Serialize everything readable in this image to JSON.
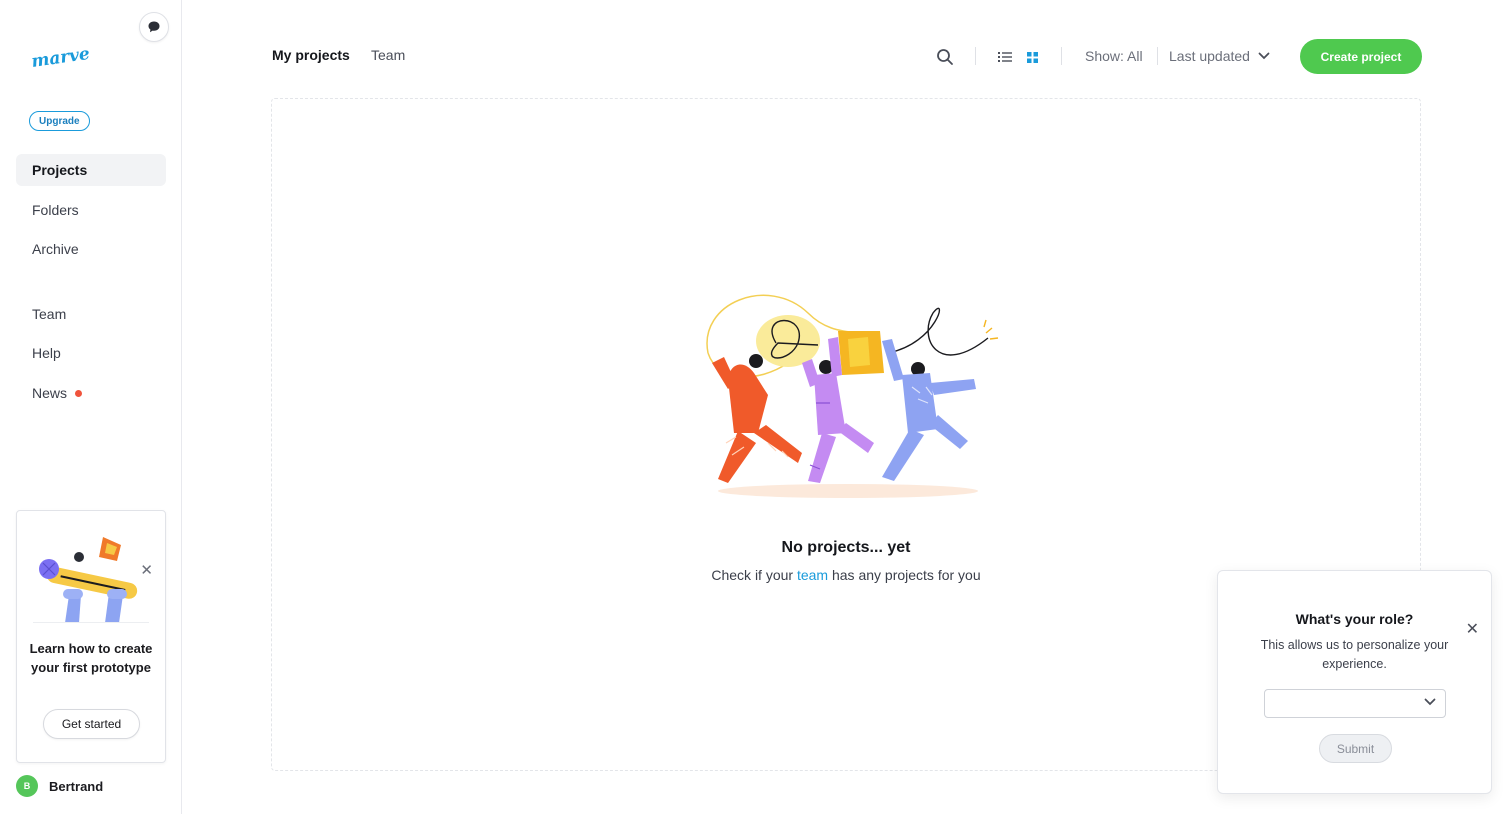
{
  "app": {
    "logo_text": "marvel",
    "upgrade_label": "Upgrade"
  },
  "sidebar": {
    "items": [
      {
        "label": "Projects",
        "active": true
      },
      {
        "label": "Folders",
        "active": false
      },
      {
        "label": "Archive",
        "active": false
      },
      {
        "label": "Team",
        "active": false
      },
      {
        "label": "Help",
        "active": false
      },
      {
        "label": "News",
        "active": false,
        "badge_color": "#f0533c"
      }
    ],
    "learn_card": {
      "text": "Learn how to create your first prototype",
      "button_label": "Get started"
    },
    "user": {
      "initial": "B",
      "name": "Bertrand",
      "avatar_color": "#55c65a"
    }
  },
  "header": {
    "tabs": [
      {
        "label": "My projects",
        "active": true
      },
      {
        "label": "Team",
        "active": false
      }
    ],
    "view_mode": "grid",
    "show_filter": "Show: All",
    "sort_label": "Last updated",
    "create_button": "Create project",
    "accent_color": "#4fc94f"
  },
  "empty_state": {
    "title": "No projects... yet",
    "subtitle_prefix": "Check if your ",
    "subtitle_link": "team",
    "subtitle_suffix": " has any projects for you"
  },
  "role_popup": {
    "title": "What's your role?",
    "description": "This allows us to personalize your experience.",
    "select_value": "",
    "submit_label": "Submit"
  }
}
